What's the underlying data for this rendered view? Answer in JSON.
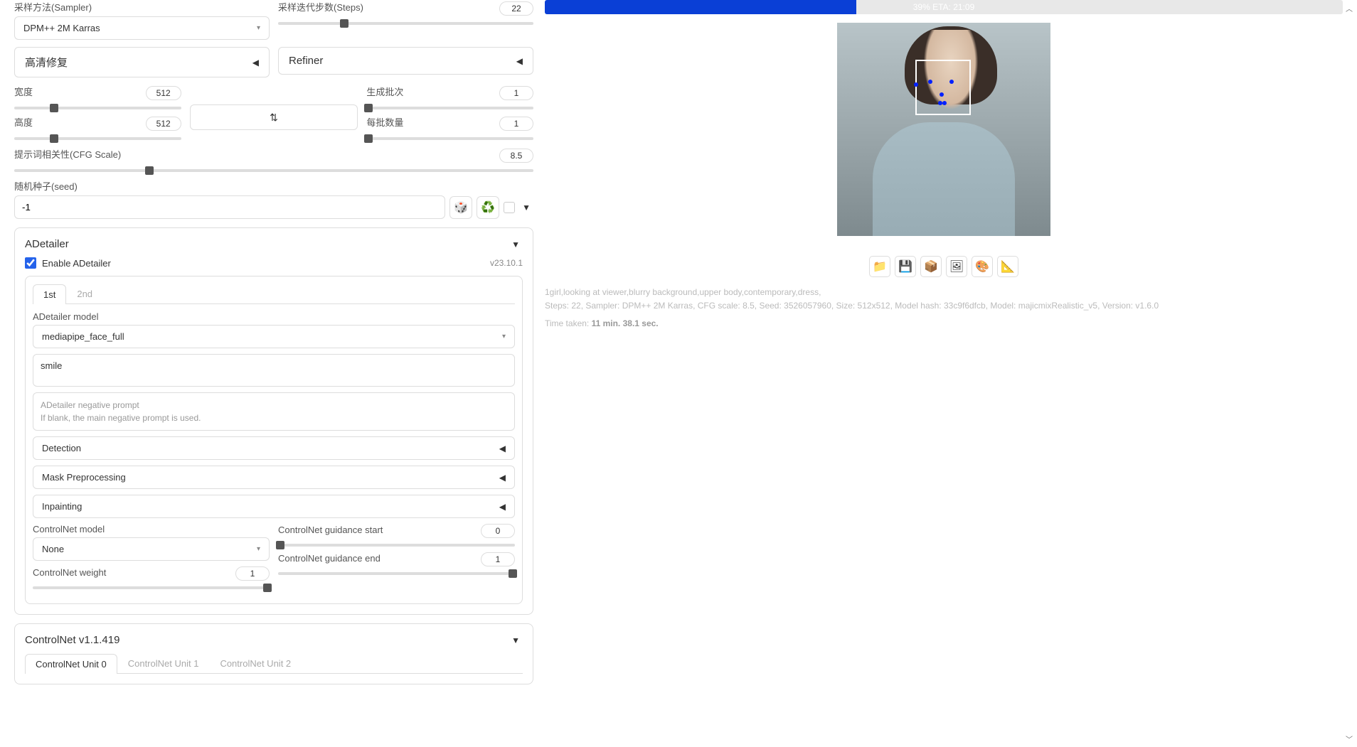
{
  "sampler": {
    "label": "采样方法(Sampler)",
    "value": "DPM++ 2M Karras"
  },
  "steps": {
    "label": "采样迭代步数(Steps)",
    "value": "22",
    "pct": 26
  },
  "hires": {
    "label": "高清修复"
  },
  "refiner": {
    "label": "Refiner"
  },
  "width": {
    "label": "宽度",
    "value": "512",
    "pct": 24
  },
  "height": {
    "label": "高度",
    "value": "512",
    "pct": 24
  },
  "batch_count": {
    "label": "生成批次",
    "value": "1",
    "pct": 1
  },
  "batch_size": {
    "label": "每批数量",
    "value": "1",
    "pct": 1
  },
  "cfg": {
    "label": "提示词相关性(CFG Scale)",
    "value": "8.5",
    "pct": 26
  },
  "seed": {
    "label": "随机种子(seed)",
    "value": "-1"
  },
  "icons": {
    "dice": "🎲",
    "recycle": "♻️",
    "swap": "⇅",
    "folder": "📁",
    "save": "💾",
    "box": "📦",
    "image": "🖼",
    "palette": "🎨",
    "ruler": "📐"
  },
  "adetailer": {
    "title": "ADetailer",
    "version": "v23.10.1",
    "enable_label": "Enable ADetailer",
    "enabled": true,
    "tabs": [
      "1st",
      "2nd"
    ],
    "active_tab": 0,
    "model_label": "ADetailer model",
    "model": "mediapipe_face_full",
    "prompt": "smile",
    "neg_placeholder1": "ADetailer negative prompt",
    "neg_placeholder2": "If blank, the main negative prompt is used.",
    "sections": {
      "detection": "Detection",
      "mask": "Mask Preprocessing",
      "inpaint": "Inpainting"
    },
    "cn_model_label": "ControlNet model",
    "cn_model": "None",
    "cn_weight_label": "ControlNet weight",
    "cn_weight": "1",
    "cn_start_label": "ControlNet guidance start",
    "cn_start": "0",
    "cn_end_label": "ControlNet guidance end",
    "cn_end": "1"
  },
  "controlnet": {
    "title": "ControlNet v1.1.419",
    "tabs": [
      "ControlNet Unit 0",
      "ControlNet Unit 1",
      "ControlNet Unit 2"
    ],
    "active_tab": 0
  },
  "progress": {
    "pct": 39,
    "text": "39% ETA: 21:09"
  },
  "gen_info": {
    "line1": "1girl,looking at viewer,blurry background,upper body,contemporary,dress,",
    "line2": "Steps: 22, Sampler: DPM++ 2M Karras, CFG scale: 8.5, Seed: 3526057960, Size: 512x512, Model hash: 33c9f6dfcb, Model: majicmixRealistic_v5, Version: v1.6.0"
  },
  "time_taken": {
    "prefix": "Time taken: ",
    "value": "11 min. 38.1 sec."
  }
}
